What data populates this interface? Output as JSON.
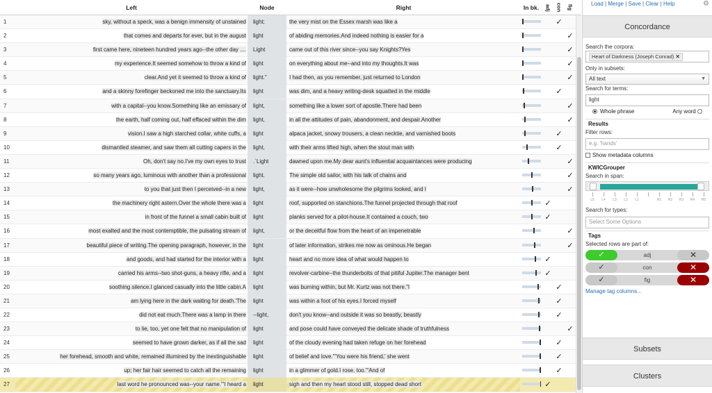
{
  "header": {
    "left": "Left",
    "node": "Node",
    "right": "Right",
    "inbk": "In bk.",
    "c1": "adj",
    "c2": "con",
    "c3": "fig"
  },
  "rows": [
    {
      "n": "1",
      "left": "sky, without a speck, was a benign immensity of unstained",
      "node": "light;",
      "right": "the very mist on the Essex marsh was like a",
      "bk": 0.0,
      "c1": "",
      "c2": "✓",
      "c3": ""
    },
    {
      "n": "2",
      "left": "that comes and departs for ever, but in the august",
      "node": "light",
      "right": "of abiding memories.And indeed nothing is easier for a",
      "bk": 0.0,
      "c1": "",
      "c2": "",
      "c3": "✓"
    },
    {
      "n": "3",
      "left": "first came here, nineteen hundred years ago--the other day ....",
      "node": "Light",
      "right": "came out of this river since--you say Knights?Yes",
      "bk": 0.0,
      "c1": "",
      "c2": "",
      "c3": "✓"
    },
    {
      "n": "4",
      "left": "my experience.It seemed somehow to throw a kind of",
      "node": "light",
      "right": "on everything about me--and into my thoughts.It was",
      "bk": 0.01,
      "c1": "",
      "c2": "",
      "c3": "✓"
    },
    {
      "n": "5",
      "left": "clear.And yet it seemed to throw a kind of",
      "node": "light.\"",
      "right": "I had then, as you remember, just returned to London",
      "bk": 0.01,
      "c1": "",
      "c2": "",
      "c3": "✓"
    },
    {
      "n": "6",
      "left": "and a skinny forefinger beckoned me into the sanctuary.Its",
      "node": "light",
      "right": "was dim, and a heavy writing-desk squatted in the middle",
      "bk": 0.05,
      "c1": "",
      "c2": "✓",
      "c3": ""
    },
    {
      "n": "7",
      "left": "with a capital--you know.Something like an emissary of",
      "node": "light,",
      "right": "something like a lower sort of apostle.There had been",
      "bk": 0.06,
      "c1": "",
      "c2": "",
      "c3": "✓"
    },
    {
      "n": "8",
      "left": "the earth, half coming out, half effaced within the dim",
      "node": "light,",
      "right": "in all the attitudes of pain, abandonment, and despair.Another",
      "bk": 0.12,
      "c1": "",
      "c2": "",
      "c3": "✓"
    },
    {
      "n": "9",
      "left": "vision.I saw a high starched collar, white cuffs, a",
      "node": "light",
      "right": "alpaca jacket, snowy trousers, a clean necktie, and varnished boots",
      "bk": 0.12,
      "c1": "",
      "c2": "✓",
      "c3": ""
    },
    {
      "n": "10",
      "left": "dismantled steamer, and saw them all cutting capers in the",
      "node": "light,",
      "right": "with their arms lifted high, when the stout man with",
      "bk": 0.22,
      "c1": "",
      "c2": "✓",
      "c3": ""
    },
    {
      "n": "11",
      "left": "Oh, don't say no.I've my own eyes to trust",
      "node": ".`Light",
      "right": "dawned upon me.My dear aunt's influential acquaintances were producing",
      "bk": 0.32,
      "c1": "",
      "c2": "",
      "c3": "✓"
    },
    {
      "n": "12",
      "left": "so many years ago, luminous with another than a professional",
      "node": "light.",
      "right": "The simple old sailor, with his talk of chains and",
      "bk": 0.5,
      "c1": "",
      "c2": "",
      "c3": "✓"
    },
    {
      "n": "13",
      "left": "to you that just then I perceived--in a new",
      "node": "light,",
      "right": "as it were--how unwholesome the pilgrims looked, and I",
      "bk": 0.55,
      "c1": "",
      "c2": "",
      "c3": "✓"
    },
    {
      "n": "14",
      "left": "the machinery right astern.Over the whole there was a",
      "node": "light",
      "right": "roof, supported on stanchions.The funnel projected through that roof",
      "bk": 0.5,
      "c1": "✓",
      "c2": "",
      "c3": ""
    },
    {
      "n": "15",
      "left": "in front of the funnel a small cabin built of",
      "node": "light",
      "right": "planks served for a pilot-house.It contained a couch, two",
      "bk": 0.5,
      "c1": "✓",
      "c2": "",
      "c3": ""
    },
    {
      "n": "16",
      "left": "most exalted and the most contemptible, the pulsating stream of",
      "node": "light,",
      "right": "or the deceitful flow from the heart of an impenetrable",
      "bk": 0.62,
      "c1": "",
      "c2": "",
      "c3": "✓"
    },
    {
      "n": "17",
      "left": "beautiful piece of writing.The opening paragraph, however, in the",
      "node": "light",
      "right": "of later information, strikes me now as ominous.He began",
      "bk": 0.65,
      "c1": "",
      "c2": "",
      "c3": "✓"
    },
    {
      "n": "18",
      "left": "and goods, and had started for the interior with a",
      "node": "light",
      "right": "heart and no more idea of what would happen to",
      "bk": 0.7,
      "c1": "✓",
      "c2": "",
      "c3": ""
    },
    {
      "n": "19",
      "left": "carried his arms--two shot-guns, a heavy rifle, and a",
      "node": "light",
      "right": "revolver-carbine--the thunderbolts of that pitiful Jupiter.The manager bent",
      "bk": 0.72,
      "c1": "✓",
      "c2": "",
      "c3": ""
    },
    {
      "n": "20",
      "left": "soothing silence.I glanced casually into the little cabin.A",
      "node": "light",
      "right": "was burning within, but Mr. Kurtz was not there.\"I",
      "bk": 0.85,
      "c1": "",
      "c2": "✓",
      "c3": ""
    },
    {
      "n": "21",
      "left": "am lying here in the dark waiting for death.'The",
      "node": "light",
      "right": "was within a foot of his eyes.I forced myself",
      "bk": 0.88,
      "c1": "",
      "c2": "✓",
      "c3": ""
    },
    {
      "n": "22",
      "left": "did not eat much.There was a lamp in there",
      "node": "--light,",
      "right": "don't you know--and outside it was so beastly, beastly",
      "bk": 0.9,
      "c1": "",
      "c2": "✓",
      "c3": ""
    },
    {
      "n": "23",
      "left": "to lie, too, yet one felt that no manipulation of",
      "node": "light",
      "right": "and pose could have conveyed the delicate shade of truthfulness",
      "bk": 0.92,
      "c1": "",
      "c2": "",
      "c3": "✓"
    },
    {
      "n": "24",
      "left": "seemed to have grown darker, as if all the sad",
      "node": "light",
      "right": "of the cloudy evening had taken refuge on her forehead",
      "bk": 0.95,
      "c1": "",
      "c2": "✓",
      "c3": ""
    },
    {
      "n": "25",
      "left": "her forehead, smooth and white, remained illumined by the inextinguishable",
      "node": "light",
      "right": "of belief and love.\"'You were his friend,' she went",
      "bk": 0.96,
      "c1": "",
      "c2": "✓",
      "c3": ""
    },
    {
      "n": "26",
      "left": "up; her fair hair seemed to catch all the remaining",
      "node": "light",
      "right": "in a glimmer of gold.I rose, too.\"'And of",
      "bk": 0.98,
      "c1": "",
      "c2": "✓",
      "c3": ""
    },
    {
      "n": "27",
      "left": "last word he pronounced was--your name.\"'I heard a",
      "node": "light",
      "right": "sigh and then my heart stood still, stopped dead short",
      "bk": 0.99,
      "c1": "✓",
      "c2": "",
      "c3": ""
    }
  ],
  "sidebar": {
    "nav": [
      "Load",
      "Merge",
      "Save",
      "Clear",
      "Help"
    ],
    "concordance": "Concordance",
    "search_corpora_label": "Search the corpora:",
    "corpus_token": "Heart of Darkness (Joseph Conrad)",
    "subsets_label": "Only in subsets:",
    "subsets_value": "All text",
    "terms_label": "Search for terms:",
    "terms_value": "light",
    "whole_phrase": "Whole phrase",
    "any_word": "Any word",
    "results": "Results",
    "filter_label": "Filter rows:",
    "filter_placeholder": "e.g. 'hands'",
    "show_meta": "Show metadata columns",
    "kwic": "KWICGrouper",
    "span_label": "Search in span:",
    "span_ticks": [
      "L5",
      "L4",
      "L3",
      "L2",
      "L1",
      "",
      "R1",
      "R2",
      "R3",
      "R4",
      "R5"
    ],
    "types_label": "Search for types:",
    "types_placeholder": "Select Some Options",
    "tags": "Tags",
    "tags_part": "Selected rows are part of:",
    "tag_items": [
      {
        "name": "adj",
        "left": "✓",
        "right": "✕"
      },
      {
        "name": "con",
        "left": "✓",
        "right": "✕"
      },
      {
        "name": "fig",
        "left": "✓",
        "right": "✕"
      }
    ],
    "manage": "Manage tag columns...",
    "subsets_section": "Subsets",
    "clusters_section": "Clusters"
  }
}
